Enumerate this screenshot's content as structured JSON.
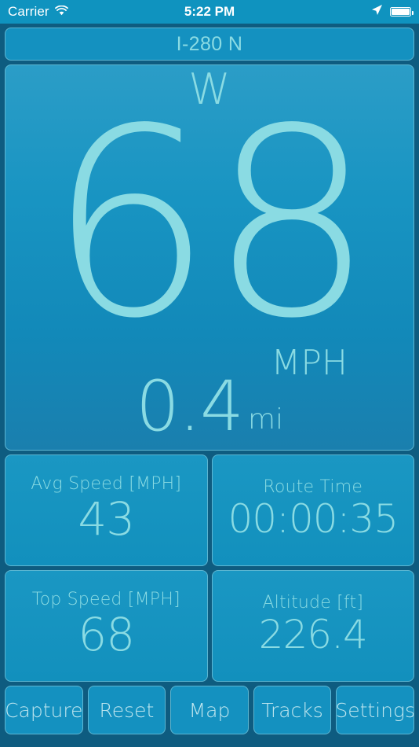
{
  "status_bar": {
    "carrier": "Carrier",
    "wifi_icon": "wifi-icon",
    "time": "5:22 PM",
    "location_icon": "location-arrow-icon",
    "battery_icon": "battery-full-icon"
  },
  "street": {
    "name": "I-280 N"
  },
  "gauge": {
    "heading": "W",
    "speed": "68",
    "speed_unit": "MPH",
    "distance": "0.4",
    "distance_unit": "mi"
  },
  "stats": [
    {
      "label": "Avg Speed [MPH]",
      "value": "43"
    },
    {
      "label": "Route Time",
      "value": "00:00:35"
    },
    {
      "label": "Top Speed [MPH]",
      "value": "68"
    },
    {
      "label": "Altitude [ft]",
      "value": "226.4"
    }
  ],
  "toolbar": [
    {
      "label": "Capture"
    },
    {
      "label": "Reset"
    },
    {
      "label": "Map"
    },
    {
      "label": "Tracks"
    },
    {
      "label": "Settings"
    }
  ],
  "colors": {
    "page_background": "#0e5c80",
    "panel_background": "#1491c0",
    "panel_border": "#5cb6d2",
    "accent_text": "#8adbe3",
    "status_bar_background": "#0f93bf",
    "status_bar_text": "#ffffff"
  }
}
